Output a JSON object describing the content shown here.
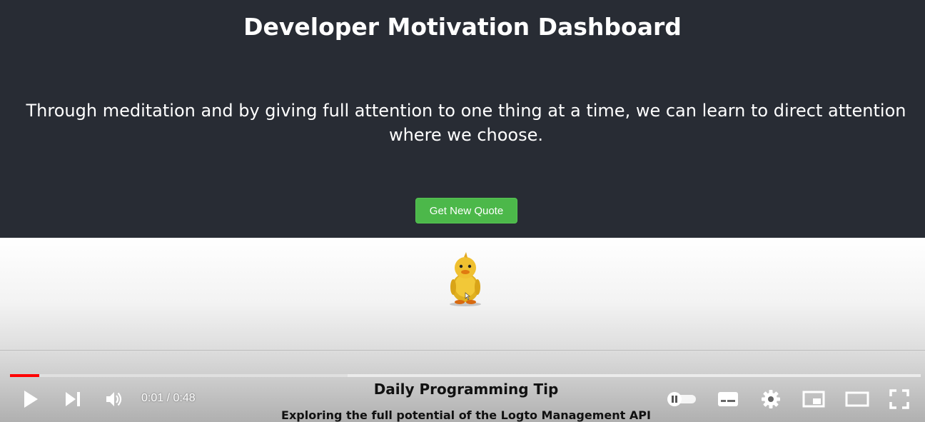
{
  "app": {
    "title": "Developer Motivation Dashboard",
    "quote": "Through meditation and by giving full attention to one thing at a time, we can learn to direct attention where we choose.",
    "button_label": "Get New Quote"
  },
  "video": {
    "subtitle_line1": "Daily Programming Tip",
    "subtitle_line2": "Exploring the full potential of the Logto Management API",
    "current_time": "0:01",
    "duration": "0:48",
    "time_display": "0:01 / 0:48",
    "played_fraction": 0.032,
    "buffered_fraction": 0.371
  },
  "icons": [
    "play-icon",
    "next-icon",
    "volume-icon",
    "autoplay-toggle-icon",
    "subtitles-icon",
    "settings-icon",
    "miniplayer-icon",
    "theater-mode-icon",
    "fullscreen-icon"
  ],
  "colors": {
    "background": "#282c34",
    "button": "#4cb84a",
    "progress_played": "#ff0000"
  }
}
